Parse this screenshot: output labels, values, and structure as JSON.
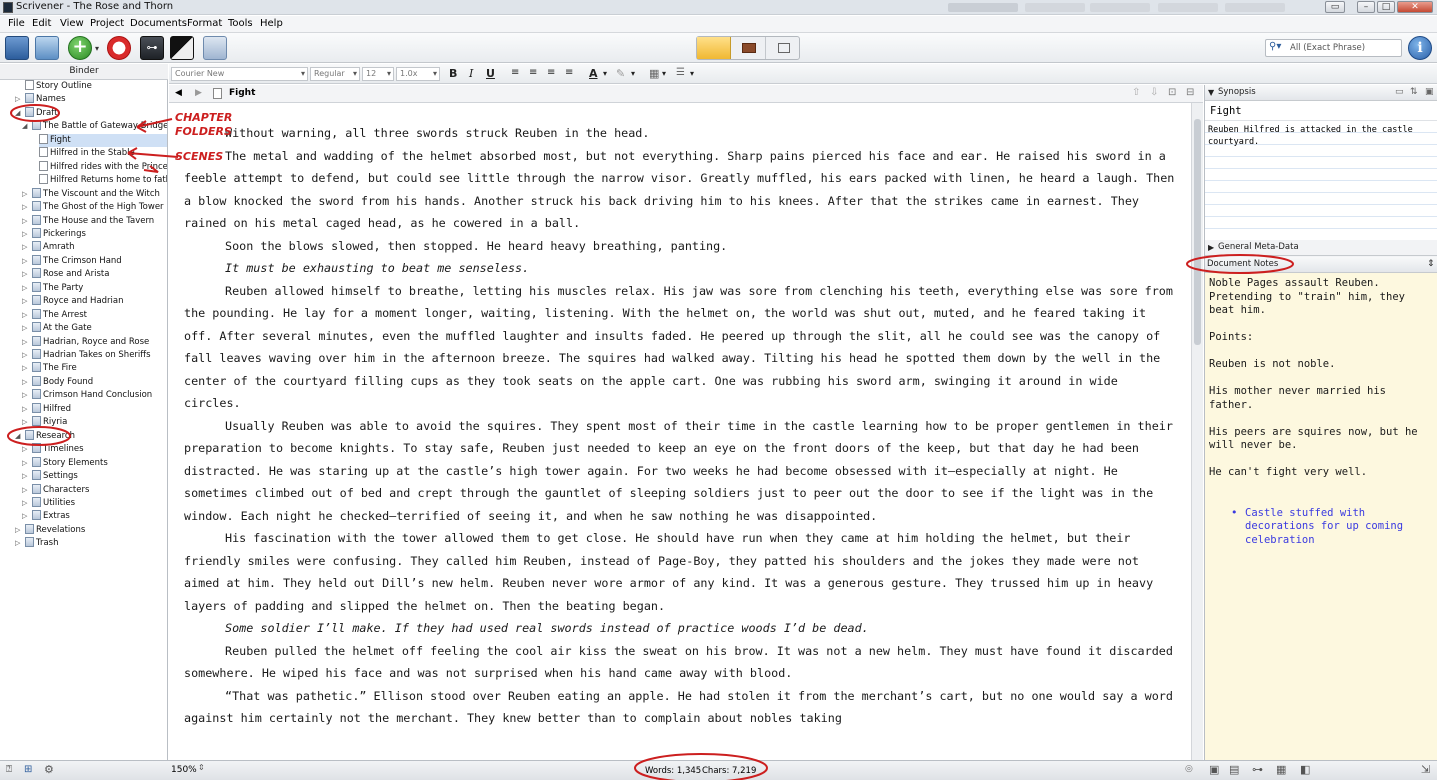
{
  "window": {
    "title": "Scrivener - The Rose and Thorn"
  },
  "menu": [
    "File",
    "Edit",
    "View",
    "Project",
    "Documents",
    "Format",
    "Tools",
    "Help"
  ],
  "toolbar": {
    "search_placeholder": "All (Exact Phrase)"
  },
  "binder": {
    "header": "Binder",
    "items": [
      {
        "label": "Story Outline",
        "level": 0,
        "icon": "doc"
      },
      {
        "label": "Names",
        "level": 0,
        "icon": "folder",
        "collapsed": true
      },
      {
        "label": "Draft",
        "level": 0,
        "icon": "draft-folder",
        "expanded": true
      },
      {
        "label": "The Battle of Gateway Bridge",
        "level": 1,
        "icon": "folder",
        "expanded": true
      },
      {
        "label": "Fight",
        "level": 2,
        "icon": "doc",
        "selected": true
      },
      {
        "label": "Hilfred in the Stable",
        "level": 2,
        "icon": "doc"
      },
      {
        "label": "Hilfred rides with the Princess",
        "level": 2,
        "icon": "doc"
      },
      {
        "label": "Hilfred Returns home to father",
        "level": 2,
        "icon": "doc"
      },
      {
        "label": "The Viscount and the Witch",
        "level": 1,
        "icon": "folder",
        "collapsed": true
      },
      {
        "label": "The Ghost of the High Tower",
        "level": 1,
        "icon": "folder",
        "collapsed": true
      },
      {
        "label": "The House and the Tavern",
        "level": 1,
        "icon": "folder",
        "collapsed": true
      },
      {
        "label": "Pickerings",
        "level": 1,
        "icon": "folder",
        "collapsed": true
      },
      {
        "label": "Amrath",
        "level": 1,
        "icon": "folder",
        "collapsed": true
      },
      {
        "label": "The Crimson Hand",
        "level": 1,
        "icon": "folder",
        "collapsed": true
      },
      {
        "label": "Rose and Arista",
        "level": 1,
        "icon": "folder",
        "collapsed": true
      },
      {
        "label": "The Party",
        "level": 1,
        "icon": "folder",
        "collapsed": true
      },
      {
        "label": "Royce and Hadrian",
        "level": 1,
        "icon": "folder",
        "collapsed": true
      },
      {
        "label": "The Arrest",
        "level": 1,
        "icon": "folder",
        "collapsed": true
      },
      {
        "label": "At the Gate",
        "level": 1,
        "icon": "folder",
        "collapsed": true
      },
      {
        "label": "Hadrian, Royce and Rose",
        "level": 1,
        "icon": "folder",
        "collapsed": true
      },
      {
        "label": "Hadrian Takes on Sheriffs",
        "level": 1,
        "icon": "folder",
        "collapsed": true
      },
      {
        "label": "The Fire",
        "level": 1,
        "icon": "folder",
        "collapsed": true
      },
      {
        "label": "Body Found",
        "level": 1,
        "icon": "folder",
        "collapsed": true
      },
      {
        "label": "Crimson Hand Conclusion",
        "level": 1,
        "icon": "folder",
        "collapsed": true
      },
      {
        "label": "Hilfred",
        "level": 1,
        "icon": "folder",
        "collapsed": true
      },
      {
        "label": "Riyria",
        "level": 1,
        "icon": "folder",
        "collapsed": true
      },
      {
        "label": "Research",
        "level": 0,
        "icon": "research-folder",
        "expanded": true
      },
      {
        "label": "Timelines",
        "level": 1,
        "icon": "folder",
        "collapsed": true
      },
      {
        "label": "Story Elements",
        "level": 1,
        "icon": "folder",
        "collapsed": true
      },
      {
        "label": "Settings",
        "level": 1,
        "icon": "folder",
        "collapsed": true
      },
      {
        "label": "Characters",
        "level": 1,
        "icon": "folder",
        "collapsed": true
      },
      {
        "label": "Utilities",
        "level": 1,
        "icon": "folder",
        "collapsed": true
      },
      {
        "label": "Extras",
        "level": 1,
        "icon": "folder",
        "collapsed": true
      },
      {
        "label": "Revelations",
        "level": 0,
        "icon": "folder",
        "collapsed": true
      },
      {
        "label": "Trash",
        "level": 0,
        "icon": "trash",
        "collapsed": true
      }
    ]
  },
  "format": {
    "font": "Courier New",
    "style": "Regular",
    "size": "12",
    "spacing": "1.0x"
  },
  "editor": {
    "doc_title": "Fight",
    "paragraphs": [
      {
        "text": "Without warning, all three swords struck Reuben in the head."
      },
      {
        "text": "The metal and wadding of the helmet absorbed most, but not everything. Sharp pains pierced his face and ear. He raised his sword in a feeble attempt to defend, but could see little through the narrow visor. Greatly muffled, his ears packed with linen, he heard a laugh. Then a blow knocked the sword from his hands. Another struck his back driving him to his knees. After that the strikes came in earnest. They rained on his metal caged head, as he cowered in a ball."
      },
      {
        "text": "Soon the blows slowed, then stopped. He heard heavy breathing, panting."
      },
      {
        "text": "It must be exhausting to beat me senseless.",
        "italic": true
      },
      {
        "text": "Reuben allowed himself to breathe, letting his muscles relax. His jaw was sore from clenching his teeth, everything else was sore from the pounding. He lay for a moment longer, waiting, listening. With the helmet on, the world was shut out, muted, and he feared taking it off. After several minutes, even the muffled laughter and insults faded. He peered up through the slit, all he could see was the canopy of fall leaves waving over him in the afternoon breeze. The squires had walked away. Tilting his head he spotted them down by the well in the center of the courtyard filling cups as they took seats on the apple cart. One was rubbing his sword arm, swinging it around in wide circles."
      },
      {
        "text": "Usually Reuben was able to avoid the squires. They spent most of their time in the castle learning how to be proper gentlemen in their preparation to become knights. To stay safe, Reuben just needed to keep an eye on the front doors of the keep, but that day he had been distracted. He was staring up at the castle’s high tower again. For two weeks he had become obsessed with it—especially at night. He sometimes climbed out of bed and crept through the gauntlet of sleeping soldiers just to peer out the door to see if the light was in the window. Each night he checked—terrified of seeing it, and when he saw nothing he was disappointed."
      },
      {
        "text": "His fascination with the tower allowed them to get close. He should have run when they came at him holding the helmet, but their friendly smiles were confusing. They called him Reuben, instead of Page-Boy, they patted his shoulders and the jokes they made were not aimed at him. They held out Dill’s new helm. Reuben never wore armor of any kind. It was a generous gesture. They trussed him up in heavy layers of padding and slipped the helmet on. Then the beating began."
      },
      {
        "text": "Some soldier I’ll make. If they had used real swords instead of practice woods I’d be dead.",
        "italic": true
      },
      {
        "text": "Reuben pulled the helmet off feeling the cool air kiss the sweat on his brow. It was not a new helm. They must have found it discarded somewhere. He wiped his face and was not surprised when his hand came away with blood."
      },
      {
        "text": "“That was pathetic.” Ellison stood over Reuben eating an apple. He had stolen it from the merchant’s cart, but no one would say a word against him certainly not the merchant. They knew better than to complain about nobles taking"
      }
    ]
  },
  "inspector": {
    "synopsis_header": "Synopsis",
    "synopsis_title": "Fight",
    "synopsis_text": "Reuben Hilfred is attacked in the castle courtyard.",
    "meta_header": "General Meta-Data",
    "notes_header": "Document Notes",
    "notes": [
      "Noble Pages assault Reuben. Pretending to \"train\" him, they beat him.",
      "Points:",
      "Reuben is not noble.",
      "His mother never married his father.",
      "His peers are squires now, but he will never be.",
      "He can't fight very well."
    ],
    "notes_bullet": "Castle stuffed with decorations for up coming celebration"
  },
  "status": {
    "zoom": "150%",
    "words": "Words: 1,345",
    "chars": "Chars: 7,219"
  },
  "annotations": {
    "chapter_folders": "CHAPTER FOLDERS",
    "scenes": "SCENES"
  },
  "colors": {
    "annotation": "#cc1f1f",
    "notes_bg": "#fdf8df",
    "selection": "#cfe0f5",
    "bullet_text": "#3a3ae0"
  }
}
